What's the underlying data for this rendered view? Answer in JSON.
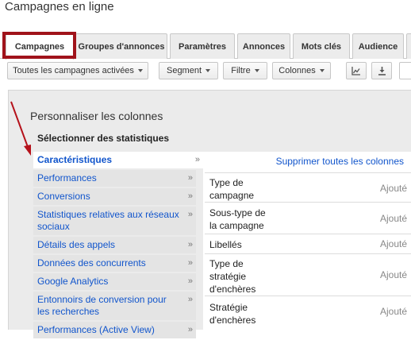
{
  "page_title": "Campagnes en ligne",
  "tabs": [
    {
      "label": "Campagnes"
    },
    {
      "label": "Groupes d'annonces"
    },
    {
      "label": "Paramètres"
    },
    {
      "label": "Annonces"
    },
    {
      "label": "Mots clés"
    },
    {
      "label": "Audience"
    }
  ],
  "toolbar": {
    "filter_campaigns": "Toutes les campagnes activées",
    "segment": "Segment",
    "filter": "Filtre",
    "columns": "Colonnes",
    "chart_icon": "chart-icon",
    "download_icon": "download-icon"
  },
  "panel": {
    "title": "Personnaliser les colonnes",
    "subtitle": "Sélectionner des statistiques",
    "categories": [
      "Caractéristiques",
      "Performances",
      "Conversions",
      "Statistiques relatives aux réseaux sociaux",
      "Détails des appels",
      "Données des concurrents",
      "Google Analytics",
      "Entonnoirs de conversion pour les recherches",
      "Performances (Active View)"
    ],
    "chevron": "»",
    "remove_all": "Supprimer toutes les colonnes",
    "rows": [
      {
        "label": "Type de campagne",
        "status": "Ajouté"
      },
      {
        "label": "Sous-type de la campagne",
        "status": "Ajouté"
      },
      {
        "label": "Libellés",
        "status": "Ajouté"
      },
      {
        "label": "Type de stratégie d'enchères",
        "status": "Ajouté"
      },
      {
        "label": "Stratégie d'enchères",
        "status": "Ajouté"
      }
    ]
  },
  "colors": {
    "highlight": "#a0131b",
    "link": "#1155cc"
  }
}
